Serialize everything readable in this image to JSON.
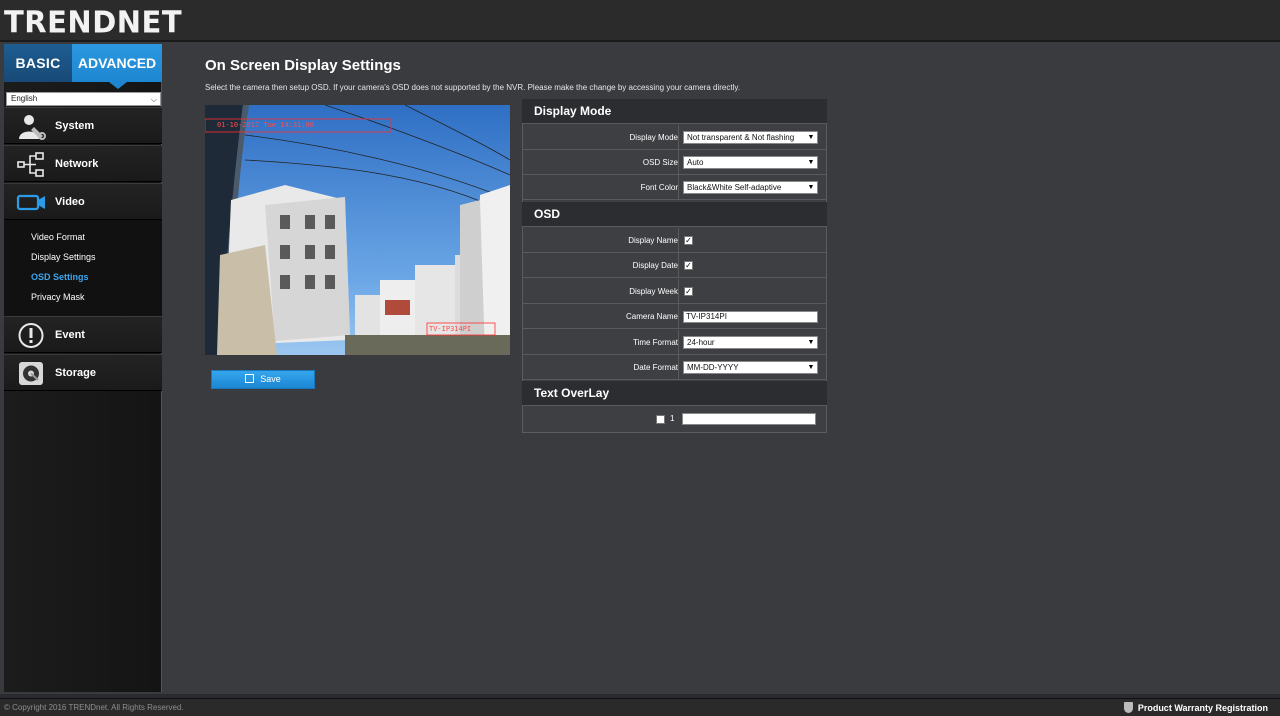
{
  "brand": {
    "logo": "TRENDNET"
  },
  "mode_tabs": {
    "basic": "BASIC",
    "advanced": "ADVANCED"
  },
  "language": {
    "selected": "English"
  },
  "sidebar": {
    "items": [
      {
        "label": "System",
        "icon": "system-icon"
      },
      {
        "label": "Network",
        "icon": "network-icon"
      },
      {
        "label": "Video",
        "icon": "video-camera-icon"
      },
      {
        "label": "Event",
        "icon": "alert-icon"
      },
      {
        "label": "Storage",
        "icon": "storage-icon"
      }
    ],
    "video_submenu": [
      "Video Format",
      "Display Settings",
      "OSD Settings",
      "Privacy Mask"
    ],
    "active_submenu": "OSD Settings"
  },
  "page": {
    "title": "On Screen Display Settings",
    "instructions": "Select the camera then setup OSD. If your camera's OSD does not supported by the NVR. Please make the change by accessing your camera directly."
  },
  "preview": {
    "osd_datetime": "01-10-2017 Tue 14:31:00",
    "osd_name": "TV-IP314PI"
  },
  "save_button": {
    "label": "Save"
  },
  "display_mode_section": {
    "title": "Display Mode",
    "rows": [
      {
        "label": "Display Mode",
        "value": "Not transparent & Not flashing"
      },
      {
        "label": "OSD Size",
        "value": "Auto"
      },
      {
        "label": "Font Color",
        "value": "Black&White Self-adaptive"
      }
    ]
  },
  "osd_section": {
    "title": "OSD",
    "display_name": {
      "label": "Display Name",
      "checked": true
    },
    "display_date": {
      "label": "Display Date",
      "checked": true
    },
    "display_week": {
      "label": "Display Week",
      "checked": true
    },
    "camera_name": {
      "label": "Camera Name",
      "value": "TV-IP314PI"
    },
    "time_format": {
      "label": "Time Format",
      "value": "24-hour"
    },
    "date_format": {
      "label": "Date Format",
      "value": "MM-DD-YYYY"
    }
  },
  "text_overlay_section": {
    "title": "Text OverLay",
    "rows": [
      {
        "index": "1",
        "checked": false,
        "value": ""
      }
    ]
  },
  "footer": {
    "copyright": "© Copyright 2016 TRENDnet. All Rights Reserved.",
    "warranty": "Product Warranty Registration"
  },
  "colors": {
    "accent": "#1e86d0",
    "active_link": "#3ba7f0",
    "panel_bg": "#3e3f43"
  }
}
